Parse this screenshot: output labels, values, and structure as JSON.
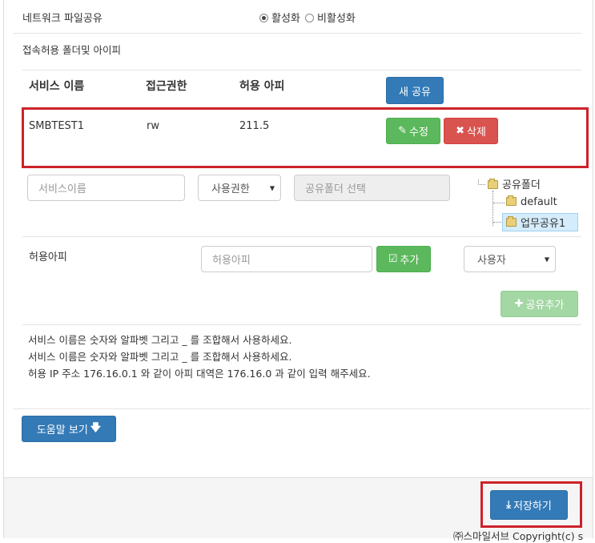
{
  "network_share": {
    "label": "네트워크 파일공유",
    "option_on": "활성화",
    "option_off": "비활성화",
    "selected": "on"
  },
  "allowed_section_label": "접속허용 폴더및 아이피",
  "table": {
    "headers": {
      "service": "서비스 이름",
      "access": "접근권한",
      "ip": "허용 아피"
    },
    "new_share_button": "새 공유",
    "rows": [
      {
        "service": "SMBTEST1",
        "access": "rw",
        "ip": "211.5",
        "edit": "수정",
        "delete": "삭제"
      }
    ]
  },
  "form": {
    "service_placeholder": "서비스이름",
    "permission_value": "사용권한",
    "folder_select_placeholder": "공유폴더 선택",
    "ip_label": "허용아피",
    "ip_placeholder": "허용아피",
    "add_button": "추가",
    "user_select_value": "사용자",
    "share_add_button": "공유추가"
  },
  "tree": {
    "root": "공유폴더",
    "children": [
      "default",
      "업무공유1"
    ],
    "selected": "업무공유1"
  },
  "help_lines": [
    "서비스 이름은 숫자와 알파벳 그리고 _ 를 조합해서 사용하세요.",
    "서비스 이름은 숫자와 알파벳 그리고 _ 를 조합해서 사용하세요.",
    "허용 IP 주소 176.16.0.1 와 같이 아피 대역은 176.16.0 과 같이 입력 해주세요."
  ],
  "help_button": "도움말 보기",
  "save_button": "저장하기",
  "footer_text": "㈜스마일서브 Copyright(c) s"
}
